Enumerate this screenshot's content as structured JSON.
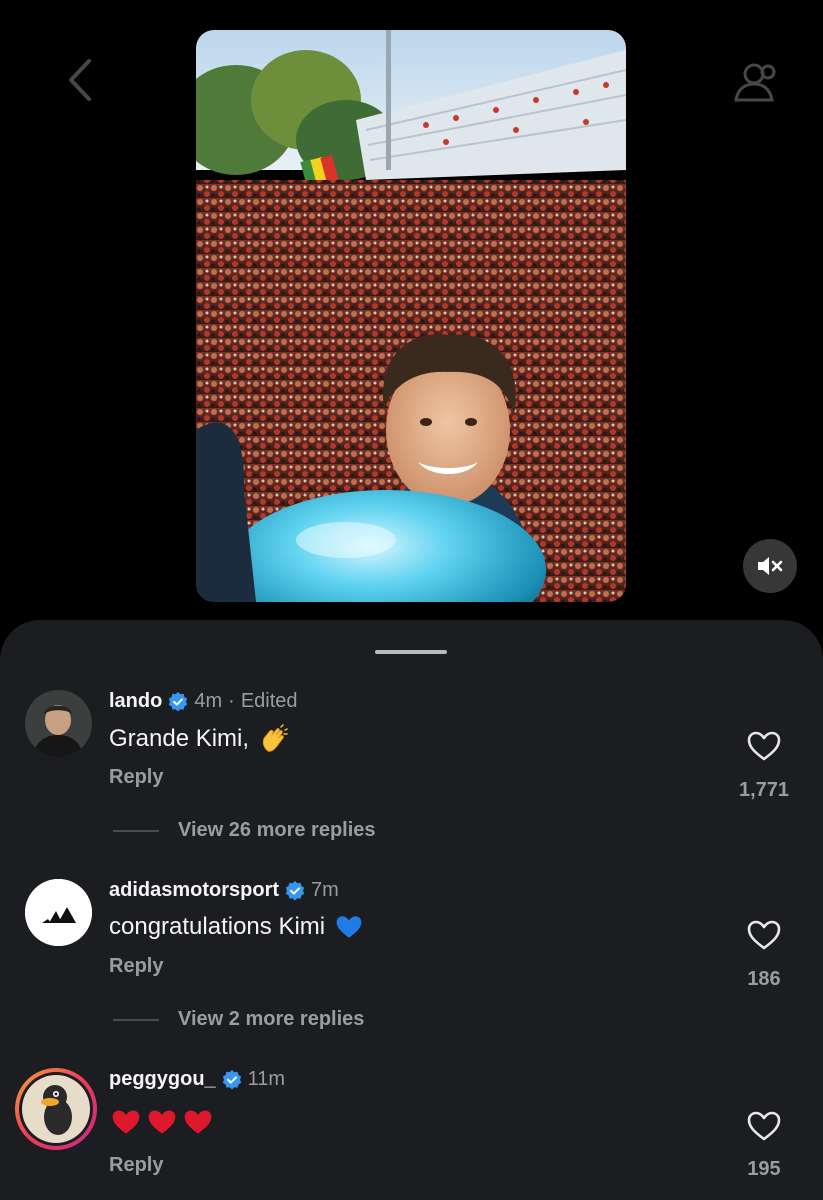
{
  "header": {
    "back_icon": "chevron-left-icon",
    "people_icon": "tag-people-icon"
  },
  "media": {
    "mute_icon": "speaker-muted-icon"
  },
  "comments": [
    {
      "username": "lando",
      "verified": true,
      "time": "4m",
      "edited": "Edited",
      "text": "Grande Kimi,",
      "emoji": "clapping-hands",
      "reply_label": "Reply",
      "likes": "1,771",
      "view_more": "View 26 more replies"
    },
    {
      "username": "adidasmotorsport",
      "verified": true,
      "time": "7m",
      "text": "congratulations Kimi",
      "emoji": "blue-heart",
      "reply_label": "Reply",
      "likes": "186",
      "view_more": "View 2 more replies"
    },
    {
      "username": "peggygou_",
      "verified": true,
      "time": "11m",
      "text": "",
      "emoji": "three-red-hearts",
      "reply_label": "Reply",
      "likes": "195"
    }
  ],
  "colors": {
    "sheet_bg": "#1c1d21",
    "muted_text": "#9b9ca1",
    "verified_blue": "#3797f0",
    "heart_red": "#e0182b",
    "story_ring_start": "#f9a13a",
    "story_ring_end": "#c8298a"
  }
}
